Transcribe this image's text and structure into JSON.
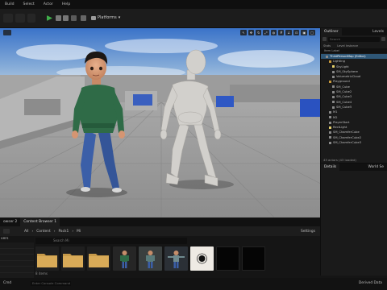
{
  "menu": [
    "Build",
    "Select",
    "Actor",
    "Help"
  ],
  "toolbar": {
    "platforms": "Platforms"
  },
  "outliner": {
    "tabs": [
      "Outliner",
      "Levels"
    ],
    "search_placeholder": "Search",
    "subtabs": [
      "Stats",
      "Level Instance"
    ],
    "col_header": "Item Label",
    "items": [
      {
        "label": "ThirdPersonMap (Editor)",
        "indent": 1,
        "kind": "level",
        "selected": true
      },
      {
        "label": "Lighting",
        "indent": 2,
        "kind": "folder"
      },
      {
        "label": "SkyLight",
        "indent": 3,
        "kind": "light"
      },
      {
        "label": "SM_SkySphere",
        "indent": 3,
        "kind": "mesh"
      },
      {
        "label": "VolumetricCloud",
        "indent": 3,
        "kind": "mesh"
      },
      {
        "label": "Playground",
        "indent": 2,
        "kind": "folder"
      },
      {
        "label": "SM_Cube",
        "indent": 3,
        "kind": "mesh"
      },
      {
        "label": "SM_Cube2",
        "indent": 3,
        "kind": "mesh"
      },
      {
        "label": "SM_Cube3",
        "indent": 3,
        "kind": "mesh"
      },
      {
        "label": "SM_Cube4",
        "indent": 3,
        "kind": "mesh"
      },
      {
        "label": "SM_Cube5",
        "indent": 3,
        "kind": "mesh"
      },
      {
        "label": "M1",
        "indent": 2,
        "kind": "mesh"
      },
      {
        "label": "M2",
        "indent": 2,
        "kind": "mesh"
      },
      {
        "label": "PlayerStart",
        "indent": 2,
        "kind": "mesh"
      },
      {
        "label": "RectLight",
        "indent": 2,
        "kind": "light"
      },
      {
        "label": "SM_ChamferCube",
        "indent": 2,
        "kind": "mesh"
      },
      {
        "label": "SM_ChamferCube2",
        "indent": 2,
        "kind": "mesh"
      },
      {
        "label": "SM_ChamferCube3",
        "indent": 2,
        "kind": "mesh"
      }
    ],
    "actors_count": "43 actors (43 loaded)"
  },
  "details": {
    "tabs": [
      "Details",
      "World Se"
    ]
  },
  "content_browser": {
    "tabs": [
      "owser 2",
      "Content Browser 1"
    ],
    "breadcrumb": [
      "All",
      "Content",
      "Pack1",
      "Mi"
    ],
    "settings": "Settings",
    "left_header": "vers",
    "search_placeholder": "Search Mi",
    "items_count": "8 items",
    "assets": [
      "folder",
      "folder",
      "folder",
      "character-green",
      "character-teal",
      "character-tpose",
      "material-dot",
      "dark",
      "dark"
    ]
  },
  "status": {
    "cmd": "Cmd",
    "console_placeholder": "Enter Console Command",
    "derived": "Derived Data"
  }
}
